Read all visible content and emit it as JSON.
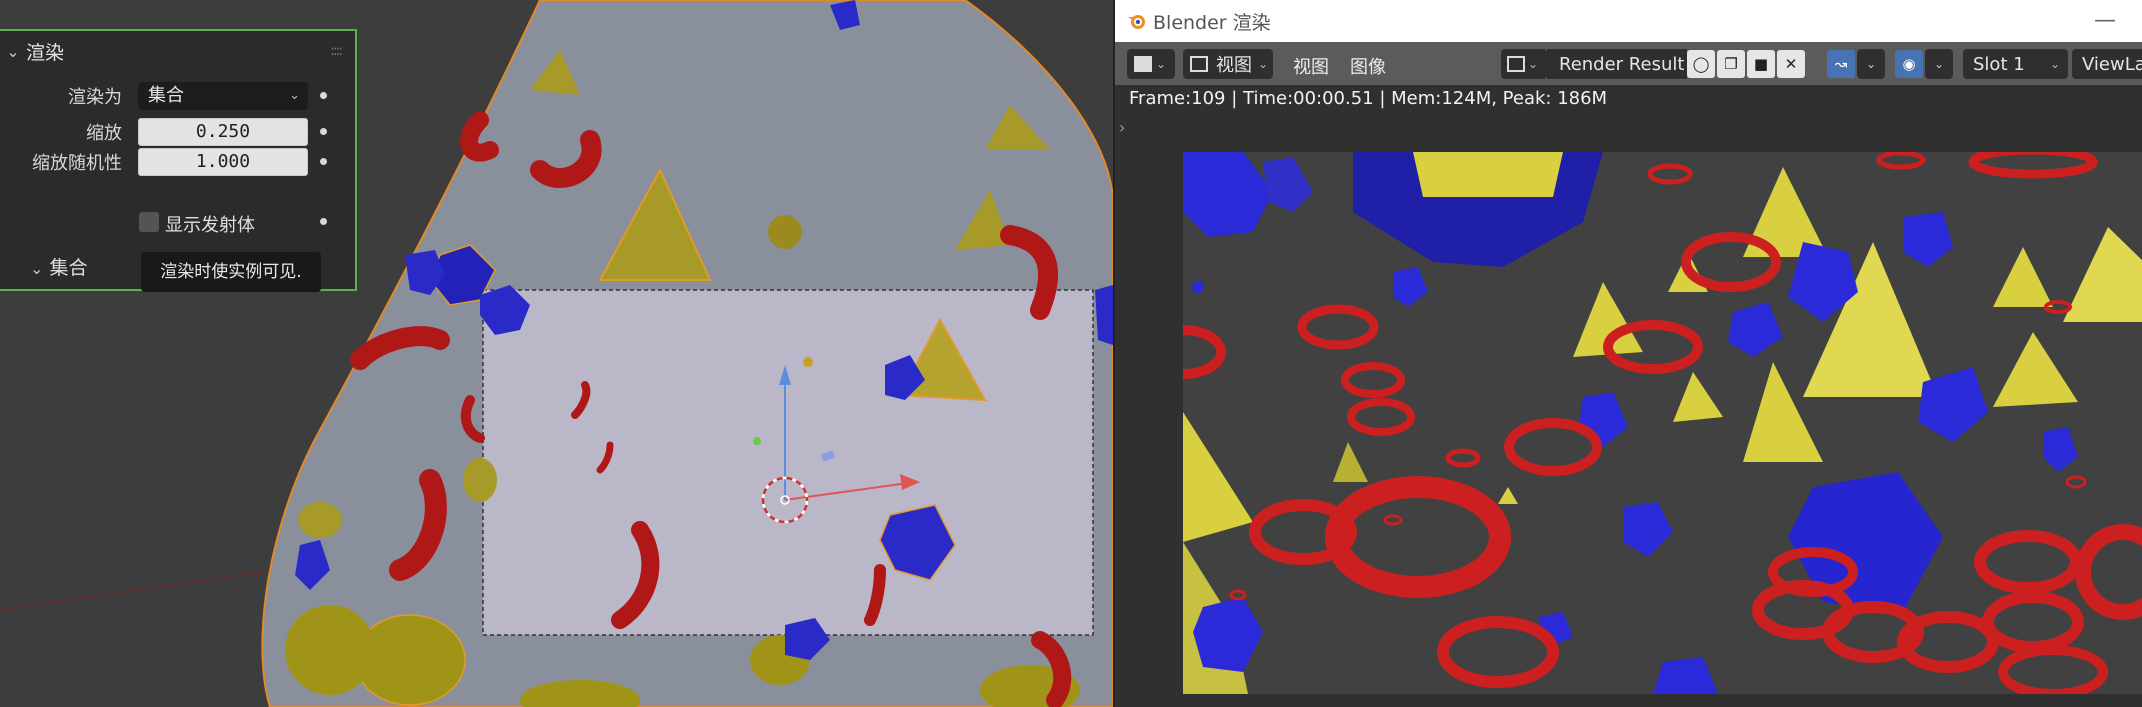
{
  "panel": {
    "header": "渲染",
    "render_as_label": "渲染为",
    "render_as_value": "集合",
    "scale_label": "缩放",
    "scale_value": "0.250",
    "scale_random_label": "缩放随机性",
    "scale_random_value": "1.000",
    "show_emitter_label": "显示发射体",
    "collection_header": "集合",
    "tooltip": "渲染时使实例可见."
  },
  "render_window": {
    "title": "Blender 渲染",
    "menu_view_dropdown": "视图",
    "menu_view": "视图",
    "menu_image": "图像",
    "image_name": "Render Result",
    "slot": "Slot 1",
    "view_layer": "ViewLay",
    "status": "Frame:109 | Time:00:00.51 | Mem:124M, Peak: 186M"
  },
  "colors": {
    "accent_green": "#5bb04f",
    "toolbar_blue": "#4772b3",
    "object_red": "#c81e1e",
    "object_blue": "#2828c8",
    "object_yellow": "#d4c838"
  }
}
